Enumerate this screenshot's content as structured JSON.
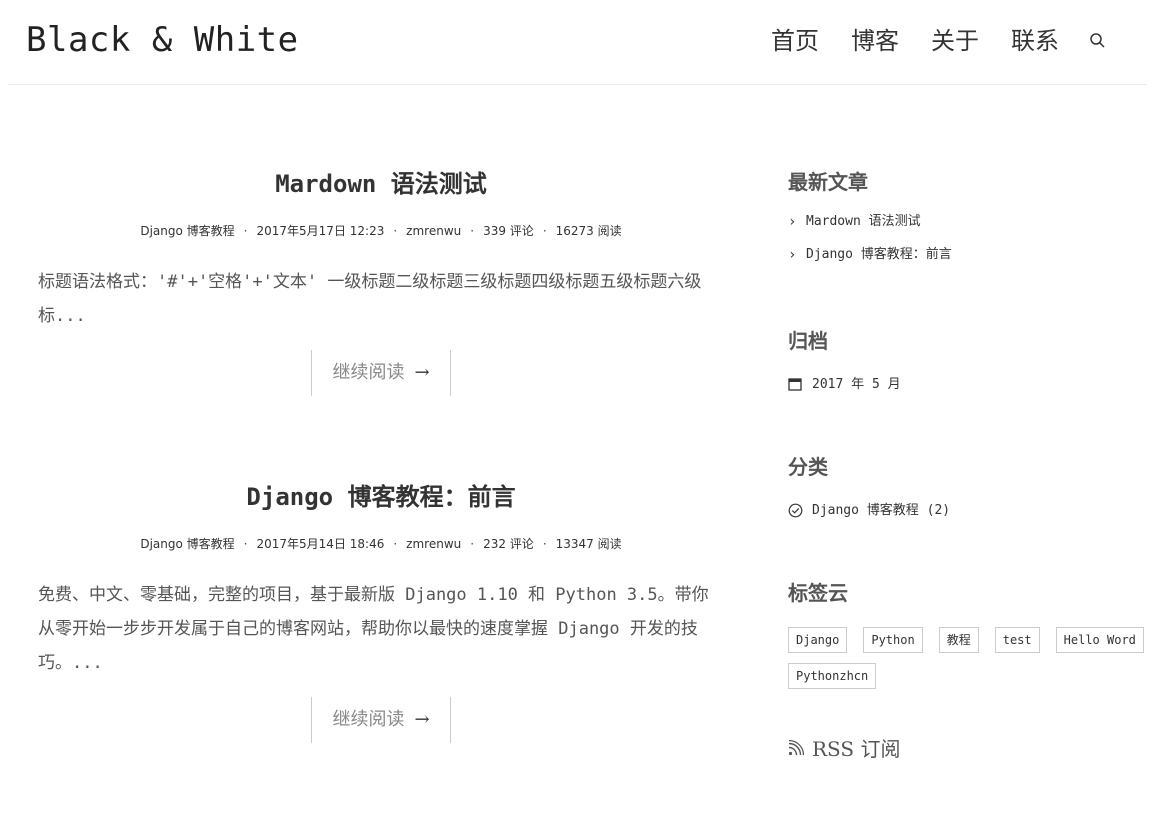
{
  "site": {
    "title": "Black & White"
  },
  "nav": {
    "items": [
      "首页",
      "博客",
      "关于",
      "联系"
    ],
    "search_icon": "search-icon"
  },
  "posts": [
    {
      "title": "Mardown 语法测试",
      "category": "Django 博客教程",
      "date": "2017年5月17日 12:23",
      "author": "zmrenwu",
      "comments": "339 评论",
      "views": "16273 阅读",
      "excerpt": "标题语法格式：'#'+'空格'+'文本' 一级标题二级标题三级标题四级标题五级标题六级标...",
      "more": "继续阅读",
      "more_arrow": "→"
    },
    {
      "title": "Django 博客教程：前言",
      "category": "Django 博客教程",
      "date": "2017年5月14日 18:46",
      "author": "zmrenwu",
      "comments": "232 评论",
      "views": "13347 阅读",
      "excerpt": "免费、中文、零基础，完整的项目，基于最新版 Django 1.10 和 Python 3.5。带你从零开始一步步开发属于自己的博客网站，帮助你以最快的速度掌握 Django 开发的技巧。...",
      "more": "继续阅读",
      "more_arrow": "→"
    }
  ],
  "sidebar": {
    "recent": {
      "title": "最新文章",
      "items": [
        "Mardown 语法测试",
        "Django 博客教程：前言"
      ],
      "icon": "chevron-right-icon"
    },
    "archive": {
      "title": "归档",
      "items": [
        "2017 年 5 月"
      ],
      "icon": "calendar-icon"
    },
    "categories": {
      "title": "分类",
      "items": [
        "Django 博客教程 (2)"
      ],
      "icon": "check-circle-icon"
    },
    "tags": {
      "title": "标签云",
      "items": [
        "Django",
        "Python",
        "教程",
        "test",
        "Hello Word",
        "Pythonzhcn"
      ]
    },
    "rss": {
      "label": "RSS 订阅",
      "icon": "rss-icon"
    }
  }
}
